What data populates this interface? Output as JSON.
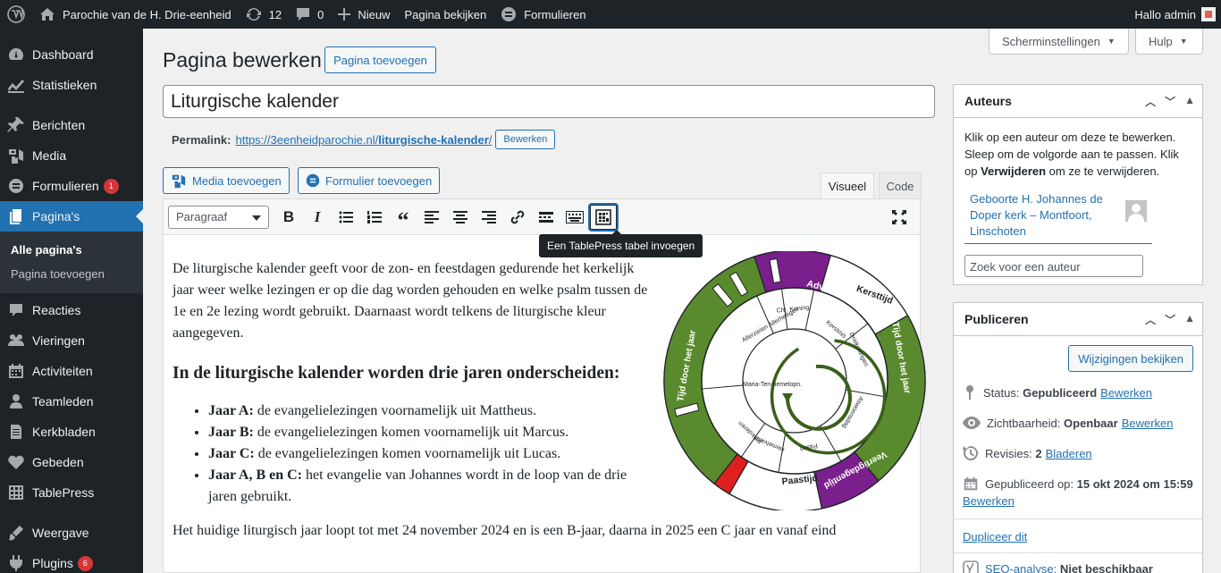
{
  "adminbar": {
    "site_name": "Parochie van de H. Drie-eenheid",
    "updates_count": "12",
    "comments_count": "0",
    "new_label": "Nieuw",
    "view_page_label": "Pagina bekijken",
    "forms_label": "Formulieren",
    "greeting": "Hallo admin"
  },
  "sidebar": {
    "items": [
      {
        "label": "Dashboard",
        "icon": "dashboard-icon"
      },
      {
        "label": "Statistieken",
        "icon": "chart-icon"
      },
      {
        "label": "Berichten",
        "icon": "pin-icon"
      },
      {
        "label": "Media",
        "icon": "media-icon"
      },
      {
        "label": "Formulieren",
        "icon": "forms-icon",
        "badge": "1"
      },
      {
        "label": "Pagina's",
        "icon": "page-icon"
      },
      {
        "label": "Reacties",
        "icon": "comment-icon"
      },
      {
        "label": "Vieringen",
        "icon": "groups-icon"
      },
      {
        "label": "Activiteiten",
        "icon": "calendar-icon"
      },
      {
        "label": "Teamleden",
        "icon": "person-icon"
      },
      {
        "label": "Kerkbladen",
        "icon": "document-icon"
      },
      {
        "label": "Gebeden",
        "icon": "heart-icon"
      },
      {
        "label": "TablePress",
        "icon": "table-icon"
      },
      {
        "label": "Weergave",
        "icon": "brush-icon"
      },
      {
        "label": "Plugins",
        "icon": "plugin-icon",
        "badge": "6"
      }
    ],
    "submenu": [
      "Alle pagina's",
      "Pagina toevoegen"
    ]
  },
  "screen_options_label": "Scherminstellingen",
  "help_label": "Hulp",
  "page_title": "Pagina bewerken",
  "add_page_button": "Pagina toevoegen",
  "post_title": "Liturgische kalender",
  "permalink": {
    "label": "Permalink:",
    "url_base": "https://3eenheidparochie.nl/",
    "url_slug": "liturgische-kalender",
    "url_end": "/",
    "edit_label": "Bewerken"
  },
  "media_button": "Media toevoegen",
  "form_button": "Formulier toevoegen",
  "editor_tabs": {
    "visual": "Visueel",
    "code": "Code"
  },
  "format_select": "Paragraaf",
  "tooltip": "Een TablePress tabel invoegen",
  "content": {
    "intro": "De liturgische kalender geeft voor de zon- en feestdagen gedurende het kerkelijk jaar weer welke lezingen er op die dag worden gehouden en welke psalm tussen de 1e en 2e lezing wordt gebruikt. Daarnaast wordt telkens de liturgische kleur aangegeven.",
    "heading": "In de liturgische kalender worden drie jaren onderscheiden:",
    "list": [
      {
        "term": "Jaar A:",
        "text": " de evangelielezingen voornamelijk uit Mattheus."
      },
      {
        "term": "Jaar B:",
        "text": " de evangelielezingen komen voornamelijk uit Marcus."
      },
      {
        "term": "Jaar C:",
        "text": " de evangelielezingen komen voornamelijk uit Lucas."
      },
      {
        "term": "Jaar A, B en C:",
        "text": " het evangelie van Johannes wordt in de loop van de drie jaren gebruikt."
      }
    ],
    "last": "Het huidige liturgisch jaar loopt tot met 24 november 2024 en is een B-jaar, daarna in 2025 een C jaar en vanaf eind"
  },
  "wheel": {
    "outer": [
      "Advent",
      "Kersttijd",
      "Tijd door het jaar",
      "Veertigdagentijd",
      "Paastijd",
      "Tijd door het jaar"
    ],
    "inner": [
      "Kerstmis",
      "Driekoningen",
      "Aswoensdag",
      "Pasen",
      "Hemelvaart",
      "Pinksteren",
      "Maria-Ten-hemelopn.",
      "Allerzielen Allerheiligen",
      "Chr. Koning"
    ]
  },
  "authors_box": {
    "title": "Auteurs",
    "help_1": "Klik op een auteur om deze te bewerken. Sleep om de volgorde aan te passen. Klik op ",
    "help_bold": "Verwijderen",
    "help_2": " om ze te verwijderen.",
    "author": "Geboorte H. Johannes de Doper kerk – Montfoort, Linschoten",
    "search_placeholder": "Zoek voor een auteur"
  },
  "publish_box": {
    "title": "Publiceren",
    "preview_button": "Wijzigingen bekijken",
    "status_label": "Status:",
    "status_value": "Gepubliceerd",
    "visibility_label": "Zichtbaarheid:",
    "visibility_value": "Openbaar",
    "revisions_label": "Revisies:",
    "revisions_value": "2",
    "revisions_link": "Bladeren",
    "published_label": "Gepubliceerd op:",
    "published_value": "15 okt 2024 om 15:59",
    "edit_link": "Bewerken",
    "duplicate_link": "Dupliceer dit",
    "seo_link": "SEO-analyse:",
    "seo_value": "Niet beschikbaar"
  },
  "colors": {
    "green": "#5a8a2e",
    "purple": "#7a1f8c",
    "red": "#e01f1f",
    "accent": "#2271b1"
  }
}
